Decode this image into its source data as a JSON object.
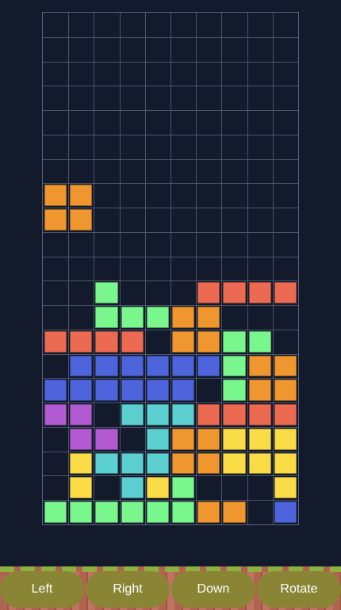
{
  "board": {
    "cols": 10,
    "rows": 20,
    "rows_data": [
      "..........",
      "..........",
      "..........",
      "..........",
      "..........",
      "..........",
      "..........",
      "OO........",
      "OO........",
      "..........",
      "..........",
      "..G...RRRR",
      "..GGGOO...",
      "RRRR.OOGG.",
      ".BBBBBBGOO",
      "BBBBBB.GOO",
      "PP.CCCRRRR",
      ".PP.COOYYY",
      ".YCCCOOYYY",
      ".Y.CYG...Y",
      "GGGGGGOO.B"
    ],
    "colors": {
      "O": "#f0962e",
      "R": "#ed6a52",
      "G": "#7af78c",
      "B": "#4e64dc",
      "C": "#5ccfd0",
      "P": "#b15ad2",
      "Y": "#fadc46"
    }
  },
  "controls": {
    "left": "Left",
    "right": "Right",
    "down": "Down",
    "rotate": "Rotate"
  }
}
